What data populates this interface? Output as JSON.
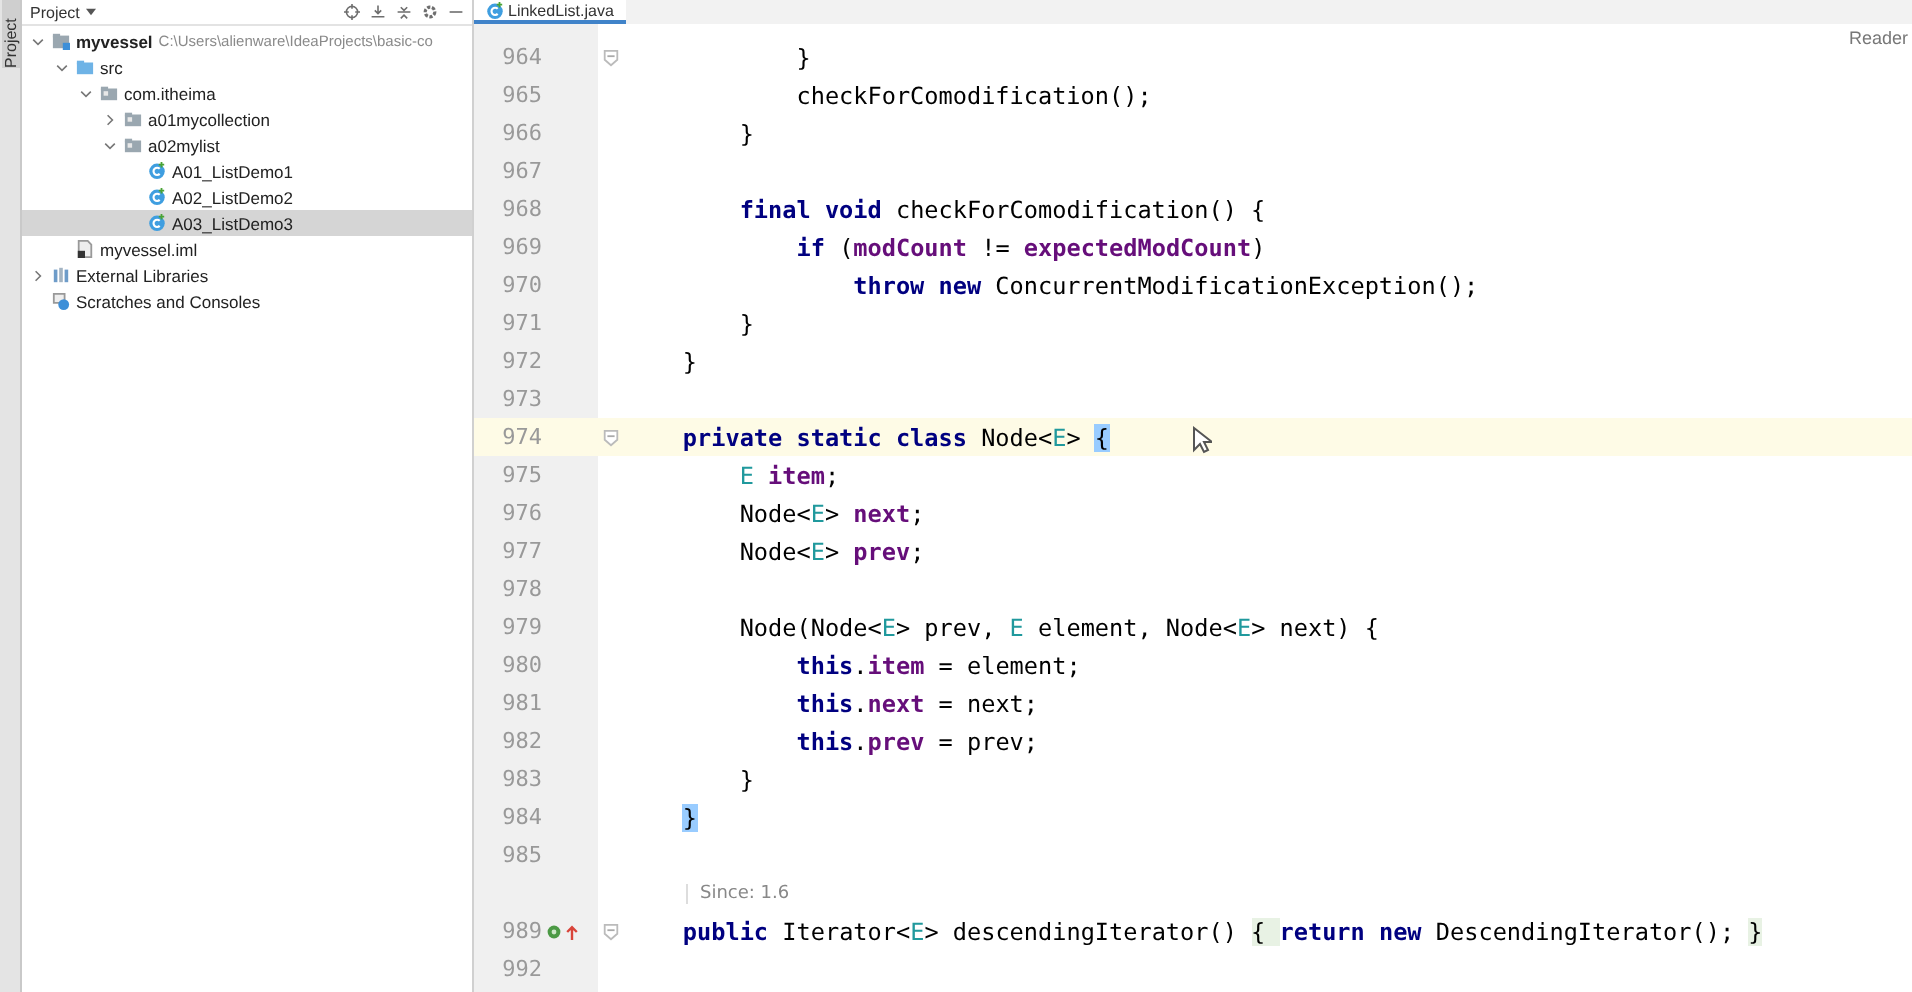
{
  "side_tab": {
    "label": "Project"
  },
  "project_panel": {
    "title": "Project",
    "tree": [
      {
        "label": "myvessel",
        "kind": "module",
        "path": "C:\\Users\\alienware\\IdeaProjects\\basic-co",
        "expanded": true,
        "selected": false,
        "children": [
          {
            "label": "src",
            "kind": "source",
            "expanded": true,
            "selected": false,
            "children": [
              {
                "label": "com.itheima",
                "kind": "package",
                "expanded": true,
                "selected": false,
                "children": [
                  {
                    "label": "a01mycollection",
                    "kind": "package",
                    "expanded": false,
                    "selected": false
                  },
                  {
                    "label": "a02mylist",
                    "kind": "package",
                    "expanded": true,
                    "selected": false,
                    "children": [
                      {
                        "label": "A01_ListDemo1",
                        "kind": "class",
                        "selected": false
                      },
                      {
                        "label": "A02_ListDemo2",
                        "kind": "class",
                        "selected": false
                      },
                      {
                        "label": "A03_ListDemo3",
                        "kind": "class",
                        "selected": true
                      }
                    ]
                  }
                ]
              }
            ]
          },
          {
            "label": "myvessel.iml",
            "kind": "file",
            "selected": false
          }
        ]
      },
      {
        "label": "External Libraries",
        "kind": "library",
        "expanded": false,
        "selected": false
      },
      {
        "label": "Scratches and Consoles",
        "kind": "scratches",
        "selected": false
      }
    ]
  },
  "editor": {
    "tab": {
      "label": "LinkedList.java",
      "selected": true
    },
    "reader_mode": "Reader",
    "lines": [
      {
        "kind": "code",
        "number": "964",
        "fold": true,
        "tokens": [
          {
            "kind": "plain",
            "text": "            }"
          }
        ]
      },
      {
        "kind": "code",
        "number": "965",
        "tokens": [
          {
            "kind": "plain",
            "text": "            checkForComodification();"
          }
        ]
      },
      {
        "kind": "code",
        "number": "966",
        "tokens": [
          {
            "kind": "plain",
            "text": "        }"
          }
        ]
      },
      {
        "kind": "code",
        "number": "967"
      },
      {
        "kind": "code",
        "number": "968",
        "tokens": [
          {
            "kind": "keyword",
            "text": "        final void"
          },
          {
            "kind": "plain",
            "text": " checkForComodification() {"
          }
        ]
      },
      {
        "kind": "code",
        "number": "969",
        "tokens": [
          {
            "kind": "keyword",
            "text": "            if"
          },
          {
            "kind": "plain",
            "text": " ("
          },
          {
            "kind": "field",
            "text": "modCount"
          },
          {
            "kind": "plain",
            "text": " != "
          },
          {
            "kind": "field",
            "text": "expectedModCount"
          },
          {
            "kind": "plain",
            "text": ")"
          }
        ]
      },
      {
        "kind": "code",
        "number": "970",
        "tokens": [
          {
            "kind": "keyword",
            "text": "                throw new"
          },
          {
            "kind": "plain",
            "text": " ConcurrentModificationException();"
          }
        ]
      },
      {
        "kind": "code",
        "number": "971",
        "tokens": [
          {
            "kind": "plain",
            "text": "        }"
          }
        ]
      },
      {
        "kind": "code",
        "number": "972",
        "tokens": [
          {
            "kind": "plain",
            "text": "    }"
          }
        ]
      },
      {
        "kind": "code",
        "number": "973"
      },
      {
        "kind": "code",
        "number": "974",
        "current": true,
        "fold": true,
        "tokens": [
          {
            "kind": "keyword",
            "text": "    private static class"
          },
          {
            "kind": "plain",
            "text": " Node<"
          },
          {
            "kind": "type",
            "text": "E"
          },
          {
            "kind": "plain",
            "text": "> "
          },
          {
            "kind": "match",
            "text": "{"
          }
        ]
      },
      {
        "kind": "code",
        "number": "975",
        "tokens": [
          {
            "kind": "type",
            "text": "        E"
          },
          {
            "kind": "field",
            "text": " item"
          },
          {
            "kind": "plain",
            "text": ";"
          }
        ]
      },
      {
        "kind": "code",
        "number": "976",
        "tokens": [
          {
            "kind": "plain",
            "text": "        Node<"
          },
          {
            "kind": "type",
            "text": "E"
          },
          {
            "kind": "plain",
            "text": "> "
          },
          {
            "kind": "field",
            "text": "next"
          },
          {
            "kind": "plain",
            "text": ";"
          }
        ]
      },
      {
        "kind": "code",
        "number": "977",
        "tokens": [
          {
            "kind": "plain",
            "text": "        Node<"
          },
          {
            "kind": "type",
            "text": "E"
          },
          {
            "kind": "plain",
            "text": "> "
          },
          {
            "kind": "field",
            "text": "prev"
          },
          {
            "kind": "plain",
            "text": ";"
          }
        ]
      },
      {
        "kind": "code",
        "number": "978"
      },
      {
        "kind": "code",
        "number": "979",
        "tokens": [
          {
            "kind": "plain",
            "text": "        Node(Node<"
          },
          {
            "kind": "type",
            "text": "E"
          },
          {
            "kind": "plain",
            "text": "> prev, "
          },
          {
            "kind": "type",
            "text": "E"
          },
          {
            "kind": "plain",
            "text": " element, Node<"
          },
          {
            "kind": "type",
            "text": "E"
          },
          {
            "kind": "plain",
            "text": "> next) {"
          }
        ]
      },
      {
        "kind": "code",
        "number": "980",
        "tokens": [
          {
            "kind": "keyword",
            "text": "            this"
          },
          {
            "kind": "plain",
            "text": "."
          },
          {
            "kind": "field",
            "text": "item"
          },
          {
            "kind": "plain",
            "text": " = element;"
          }
        ]
      },
      {
        "kind": "code",
        "number": "981",
        "tokens": [
          {
            "kind": "keyword",
            "text": "            this"
          },
          {
            "kind": "plain",
            "text": "."
          },
          {
            "kind": "field",
            "text": "next"
          },
          {
            "kind": "plain",
            "text": " = next;"
          }
        ]
      },
      {
        "kind": "code",
        "number": "982",
        "tokens": [
          {
            "kind": "keyword",
            "text": "            this"
          },
          {
            "kind": "plain",
            "text": "."
          },
          {
            "kind": "field",
            "text": "prev"
          },
          {
            "kind": "plain",
            "text": " = prev;"
          }
        ]
      },
      {
        "kind": "code",
        "number": "983",
        "tokens": [
          {
            "kind": "plain",
            "text": "        }"
          }
        ]
      },
      {
        "kind": "code",
        "number": "984",
        "tokens": [
          {
            "kind": "match",
            "text": "    }"
          }
        ]
      },
      {
        "kind": "code",
        "number": "985"
      },
      {
        "kind": "hint",
        "text": "Since: 1.6"
      },
      {
        "kind": "code",
        "number": "989",
        "fold": true,
        "marked": true,
        "tokens": [
          {
            "kind": "keyword",
            "text": "    public"
          },
          {
            "kind": "plain",
            "text": " Iterator<"
          },
          {
            "kind": "type",
            "text": "E"
          },
          {
            "kind": "plain",
            "text": "> descendingIterator() "
          },
          {
            "kind": "folded",
            "text": "{ "
          },
          {
            "kind": "keyword",
            "text": "return new"
          },
          {
            "kind": "plain",
            "text": " DescendingIterator(); "
          },
          {
            "kind": "folded",
            "text": "}"
          }
        ]
      },
      {
        "kind": "code",
        "number": "992"
      }
    ]
  }
}
